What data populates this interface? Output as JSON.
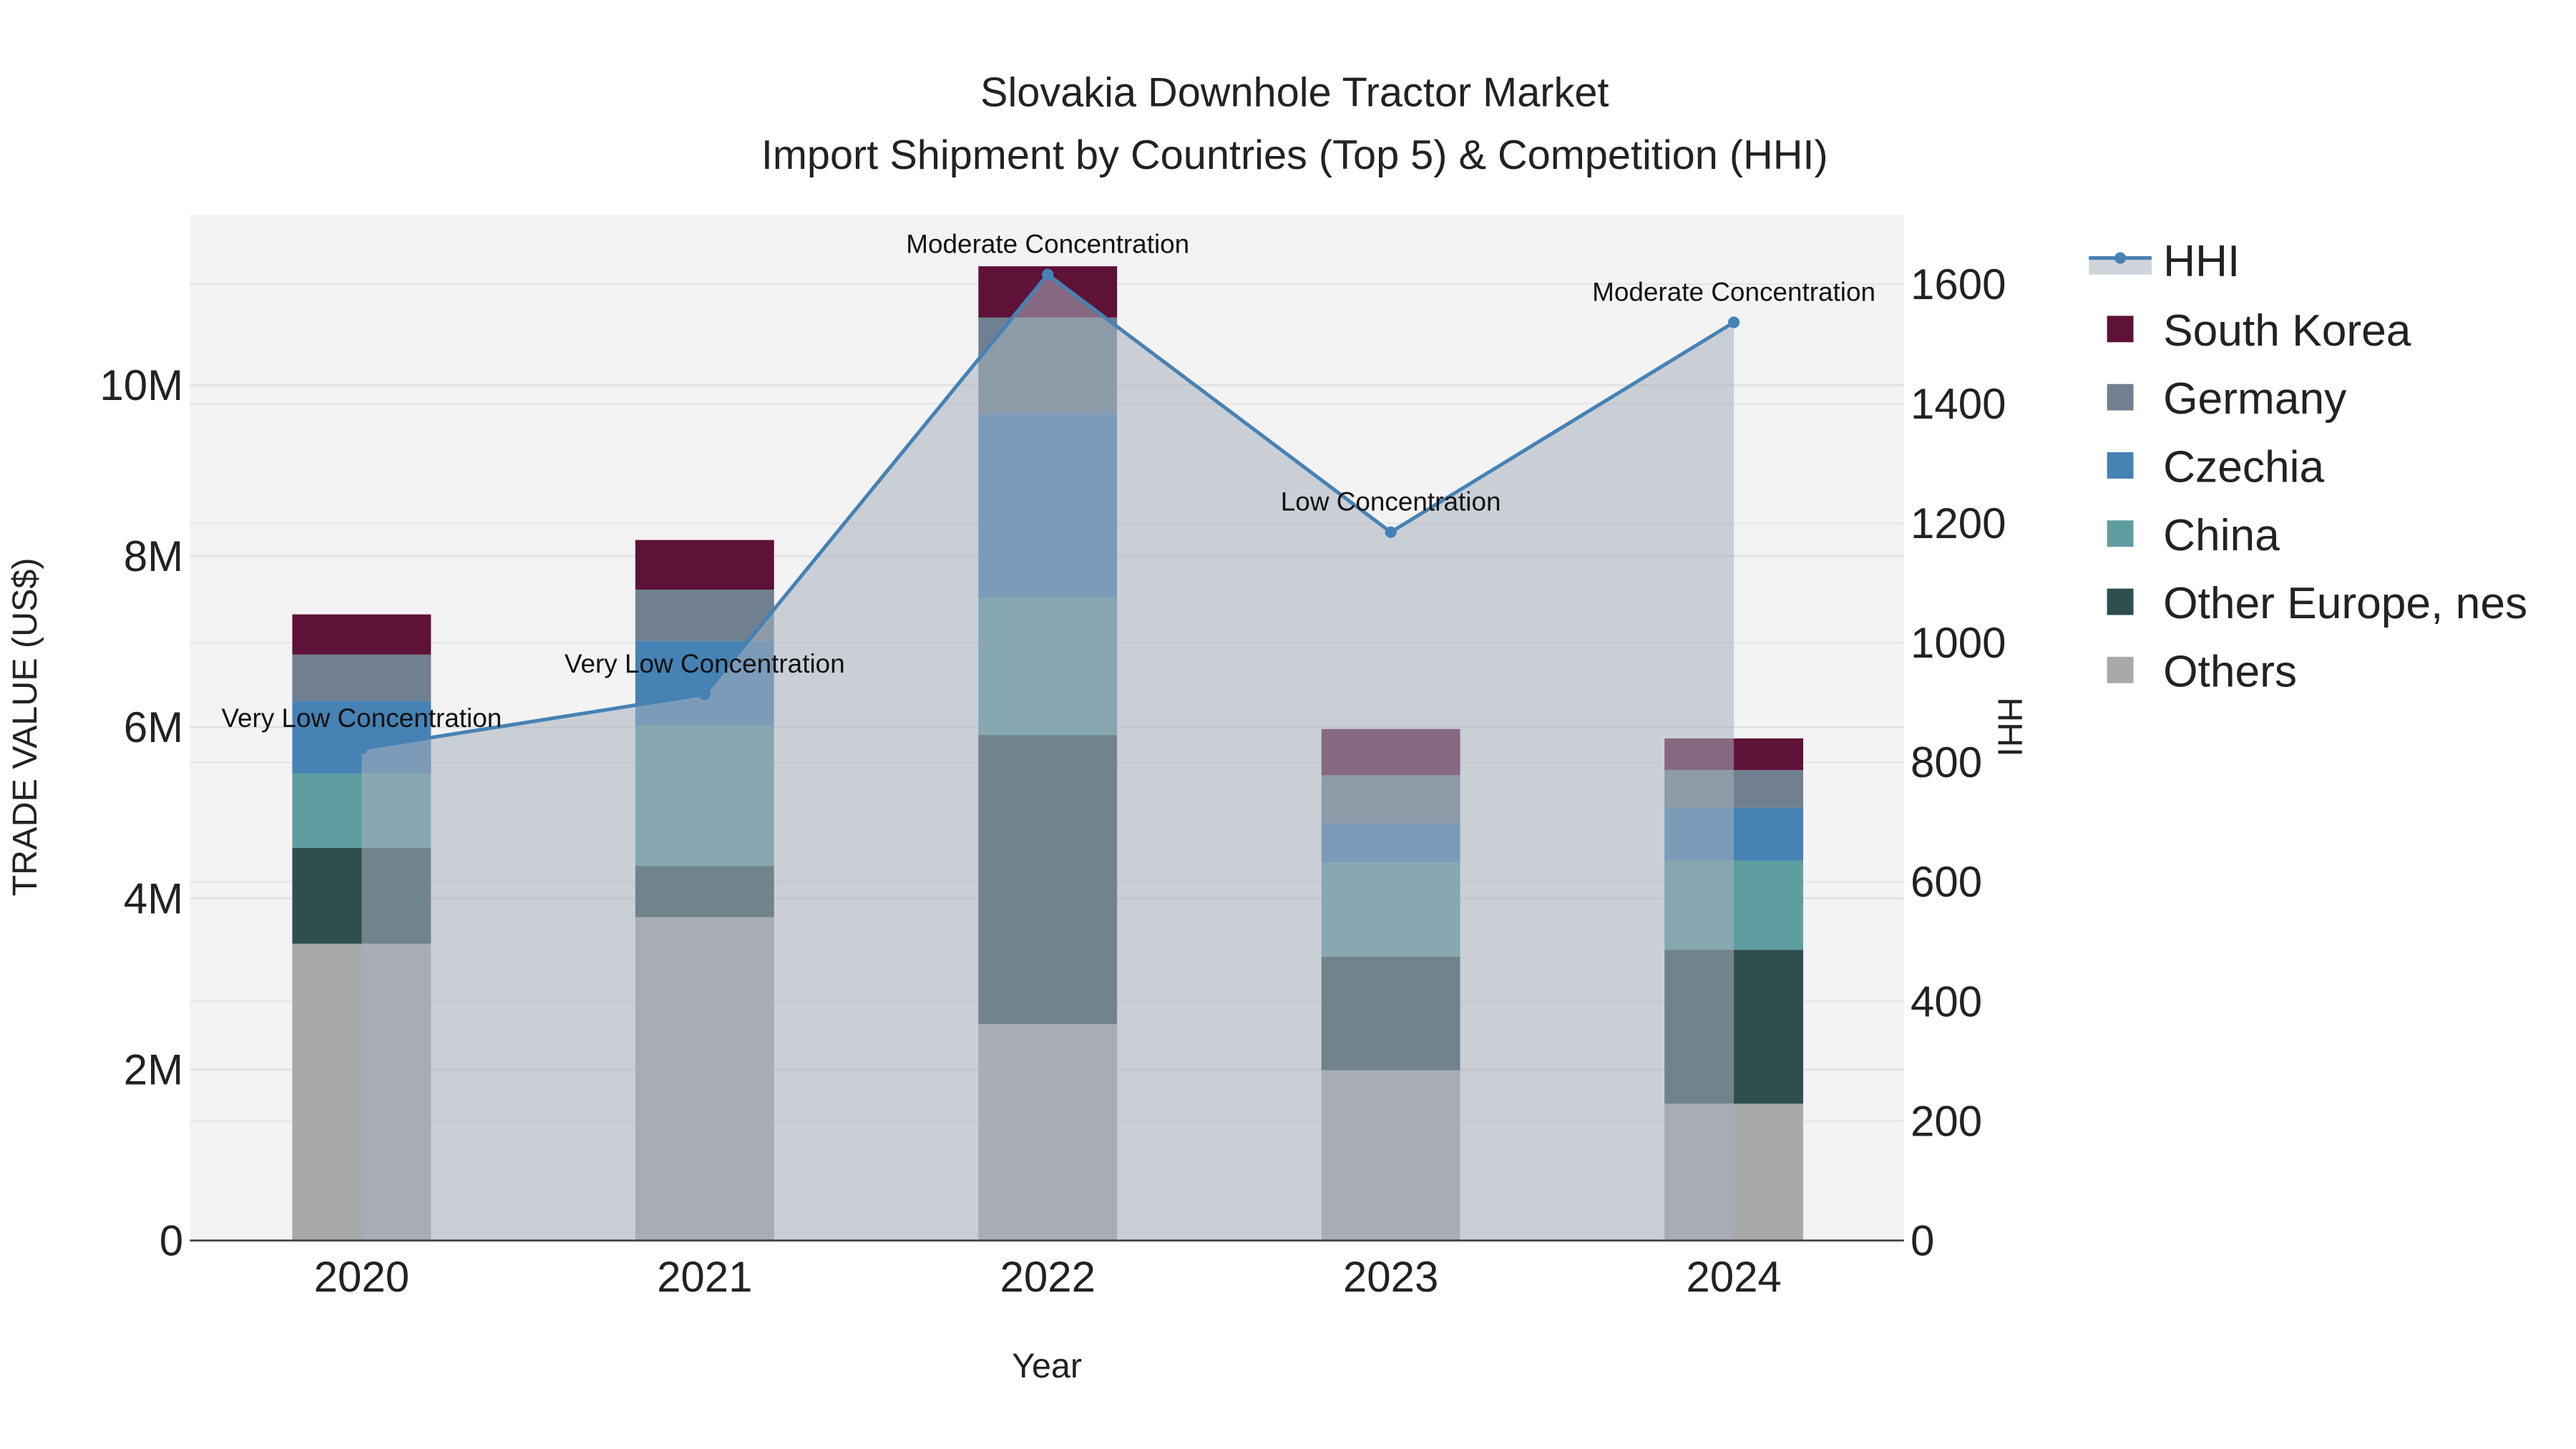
{
  "chart_data": {
    "type": "bar",
    "stacked": true,
    "title_line1": "Slovakia Downhole Tractor Market",
    "title_line2": "Import Shipment by Countries (Top 5) & Competition (HHI)",
    "xlabel": "Year",
    "ylabel": "TRADE VALUE (US$)",
    "y2label": "HHI",
    "categories": [
      "2020",
      "2021",
      "2022",
      "2023",
      "2024"
    ],
    "ylim": [
      0,
      12000000
    ],
    "y2lim": [
      0,
      1700
    ],
    "yticks": [
      0,
      2000000,
      4000000,
      6000000,
      8000000,
      10000000
    ],
    "ytick_labels": [
      "0",
      "2M",
      "4M",
      "6M",
      "8M",
      "10M"
    ],
    "y2ticks": [
      0,
      200,
      400,
      600,
      800,
      1000,
      1200,
      1400,
      1600
    ],
    "y2tick_labels": [
      "0",
      "200",
      "400",
      "600",
      "800",
      "1000",
      "1200",
      "1400",
      "1600"
    ],
    "series": [
      {
        "name": "Others",
        "color": "#a9a9a9",
        "values": [
          3470000,
          3780000,
          2530000,
          1990000,
          1600000
        ]
      },
      {
        "name": "Other Europe, nes",
        "color": "#2f4f4f",
        "values": [
          1120000,
          600000,
          3380000,
          1330000,
          1800000
        ]
      },
      {
        "name": "China",
        "color": "#5f9ea0",
        "values": [
          870000,
          1640000,
          1600000,
          1100000,
          1040000
        ]
      },
      {
        "name": "Czechia",
        "color": "#4682b4",
        "values": [
          850000,
          990000,
          2160000,
          460000,
          620000
        ]
      },
      {
        "name": "Germany",
        "color": "#708090",
        "values": [
          540000,
          600000,
          1120000,
          560000,
          440000
        ]
      },
      {
        "name": "South Korea",
        "color": "#5e1238",
        "values": [
          470000,
          580000,
          600000,
          540000,
          370000
        ]
      }
    ],
    "hhi": {
      "name": "HHI",
      "color": "#4682b4",
      "values": [
        823,
        914,
        1616,
        1185,
        1536
      ],
      "annotations": [
        "Very Low Concentration",
        "Very Low Concentration",
        "Moderate Concentration",
        "Low Concentration",
        "Moderate Concentration"
      ]
    },
    "legend": [
      "HHI",
      "South Korea",
      "Germany",
      "Czechia",
      "China",
      "Other Europe, nes",
      "Others"
    ],
    "legend_position": "right",
    "grid": true
  }
}
